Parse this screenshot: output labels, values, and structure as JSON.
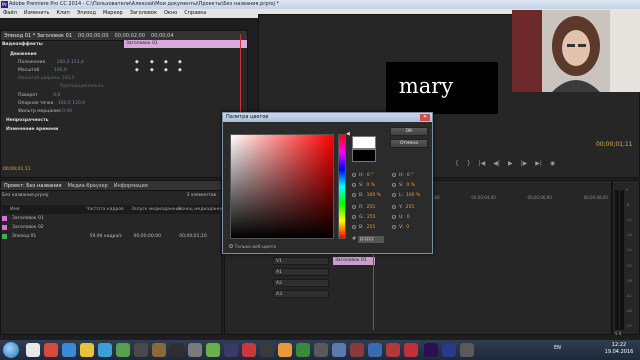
{
  "window": {
    "title": "Adobe Premiere Pro CC 2014 - C:\\Пользователи\\Алексей\\Мои документы\\Проекты\\Без названия.prproj *"
  },
  "menu": [
    "Файл",
    "Изменить",
    "Клип",
    "Эпизод",
    "Маркер",
    "Заголовок",
    "Окно",
    "Справка"
  ],
  "effect_controls": {
    "tabs": [
      "Эпизод 01 * Заголовок 01",
      "00;00;00;00",
      "00;00;02;00",
      "00;00;04"
    ],
    "header": "Видеоэффекты",
    "clip_strip": "Заголовок 01",
    "rows": [
      {
        "label": "Движение",
        "strong": true
      },
      {
        "label": "Положение",
        "v1": "160,0",
        "v2": "153,4"
      },
      {
        "label": "Масштаб",
        "v1": "100,0"
      },
      {
        "label": "Масштаб ширины",
        "v1": "100,0"
      },
      {
        "label": "Пропорционально",
        "v1": ""
      },
      {
        "label": "Поворот",
        "v1": "0,0"
      },
      {
        "label": "Опорная точка",
        "v1": "160,0",
        "v2": "120,0"
      },
      {
        "label": "Фильтр мерцания",
        "v1": "0,00"
      },
      {
        "label": "Непрозрачность",
        "strong": true
      },
      {
        "label": "Изменение времени",
        "strong": true
      }
    ],
    "current_time": "00;00;01;11"
  },
  "program_monitor": {
    "canvas_text": "mary",
    "timecode": "00;00;01;11"
  },
  "project_panel": {
    "tabs": [
      "Проект: Без названия",
      "Медиа-браузер",
      "Информация"
    ],
    "project_file": "Без названия.prproj",
    "item_count": "3 элементов",
    "columns": [
      "Имя",
      "Частота кадров",
      "Запуск медиаданных",
      "Конец медиаданных"
    ],
    "items": [
      {
        "name": "Заголовок 01",
        "fps": "",
        "start": "",
        "end": "",
        "color": "#d46fd6"
      },
      {
        "name": "Заголовок 02",
        "fps": "",
        "start": "",
        "end": "",
        "color": "#d46fd6"
      },
      {
        "name": "Эпизод 01",
        "fps": "59,94 кадра/с",
        "start": "00;00;00;00",
        "end": "00;00;01;10",
        "color": "#3fae5a"
      }
    ]
  },
  "sequence": {
    "timecode": "00;00;01;11",
    "ruler": [
      "00;00",
      "00;00;02;00",
      "00;00;04;00",
      "00;00;06;00",
      "00;00;08;00"
    ],
    "tracks": [
      "V1",
      "A1",
      "A2",
      "A3"
    ],
    "clip_label": "Заголовок 01"
  },
  "audio_meter": {
    "scale": [
      "0",
      "-6",
      "-12",
      "-18",
      "-24",
      "-30",
      "-36",
      "-42",
      "-48",
      "-54"
    ],
    "solo": "S S"
  },
  "color_dialog": {
    "title": "Палитра цветов",
    "close": "✕",
    "ok": "ОК",
    "cancel": "Отмена",
    "values": {
      "H": "0 °",
      "S": "0 %",
      "B": "100 %",
      "R": "255",
      "G": "255",
      "Bl": "255",
      "H2": "0 °",
      "S2": "0 %",
      "L": "100 %",
      "Y": "255",
      "U": "0",
      "V": "0"
    },
    "hex": "FFFFFF",
    "websafe_label": "Только веб-цвета"
  },
  "taskbar": {
    "lang": "EN",
    "time": "12:22",
    "date": "19.04.2016"
  },
  "colors": {
    "accent_clip": "#d9a9dc",
    "playhead": "#cc3333",
    "timecode": "#e6b24b"
  }
}
